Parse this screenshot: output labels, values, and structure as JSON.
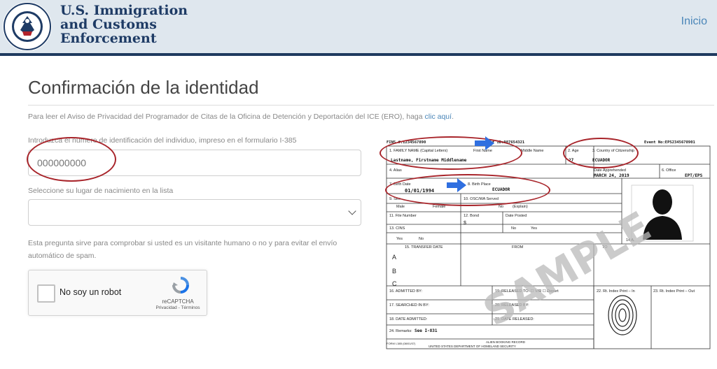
{
  "header": {
    "agency_line1": "U.S. Immigration",
    "agency_line2": "and Customs",
    "agency_line3": "Enforcement",
    "nav_home": "Inicio",
    "seal_text_top": "U.S. DEPARTMENT OF",
    "seal_text_bottom": "HOMELAND SECURITY"
  },
  "page": {
    "title": "Confirmación de la identidad",
    "privacy_text": "Para leer el Aviso de Privacidad del Programador de Citas de la Oficina de Detención y Deportación del ICE (ERO), haga ",
    "privacy_link": "clic aquí",
    "privacy_end": "."
  },
  "form": {
    "id_label": "Introduzca el número de identificación del individuo, impreso en el formulario I-385",
    "id_placeholder": "000000000",
    "birthplace_label": "Seleccione su lugar de nacimiento en la lista",
    "birthplace_selected": "",
    "human_note": "Esta pregunta sirve para comprobar si usted es un visitante humano o no y para evitar el envío automático de spam."
  },
  "recaptcha": {
    "label": "No soy un robot",
    "brand": "reCAPTCHA",
    "links": "Privacidad - Términos"
  },
  "sample_form": {
    "fins": "FINS #:1234567890",
    "subject_id": "Subject ID:987654321",
    "event_no": "Event No:EPS2345678901",
    "family_name_label": "1. FAMILY NAME (Capital Letters)",
    "first_name_label": "First Name",
    "middle_name_label": "Middle Name",
    "name_value": "Lastname, Firstname Middlename",
    "age_label": "2. Age",
    "age_value": "27",
    "citizenship_label": "3. Country of Citizenship",
    "citizenship_value": "ECUADOR",
    "alias_label": "4. Alias",
    "date_apprehended_label": "Date Apprehended",
    "date_apprehended_value": "MARCH 24, 2019",
    "office_label": "6. Office",
    "office_value": "EPT/EPS",
    "birth_date_label": "7. Birth Date",
    "birth_date_value": "01/01/1994",
    "birth_place_label": "8. Birth Place",
    "birth_place_value": "ECUADOR",
    "sex_label": "9. Sex",
    "male": "Male",
    "female": "Female",
    "osc_label": "10. OSC/WA Served",
    "no": "No",
    "explain": "(Explain)",
    "file_number_label": "11. File Number",
    "bond_label": "12. Bond",
    "bond_value": "$",
    "date_posted_label": "Date Posted",
    "cins_label": "13. CINS",
    "yes": "Yes",
    "photo_num": "14 A.",
    "transfer_date_label": "15. TRANSFER DATE",
    "from_label": "FROM",
    "to_label": "TO",
    "row_a": "A",
    "row_b": "B",
    "row_c": "C",
    "admitted_by": "16. ADMITTED BY:",
    "released_to": "19. RELEASED TO: ☐ V/R ☐ Deport",
    "searched_by": "17. SEARCHED IN BY:",
    "released_by": "20. RELEASED BY:",
    "date_admitted": "18. DATE ADMITTED:",
    "date_released": "21. DATE RELEASED:",
    "remarks_label": "24. Remarks:",
    "remarks_value": "See I-831",
    "rt_index_in": "22. Rt. Index Print – In",
    "rt_index_out": "23. Rt. Index Print – Out",
    "form_no": "FORM I-385 (08/01/07)",
    "booking_record": "ALIEN BOOKING RECORD",
    "department": "UNITED STATES DEPARTMENT OF HOMELAND SECURITY",
    "watermark": "SAMPLE"
  },
  "colors": {
    "header_bg": "#dfe7ee",
    "header_rule": "#1f3a5f",
    "brand_text": "#1e3b65",
    "link": "#4a86b8",
    "annotation_oval": "#a8242a",
    "annotation_arrow": "#2f6fe0"
  }
}
